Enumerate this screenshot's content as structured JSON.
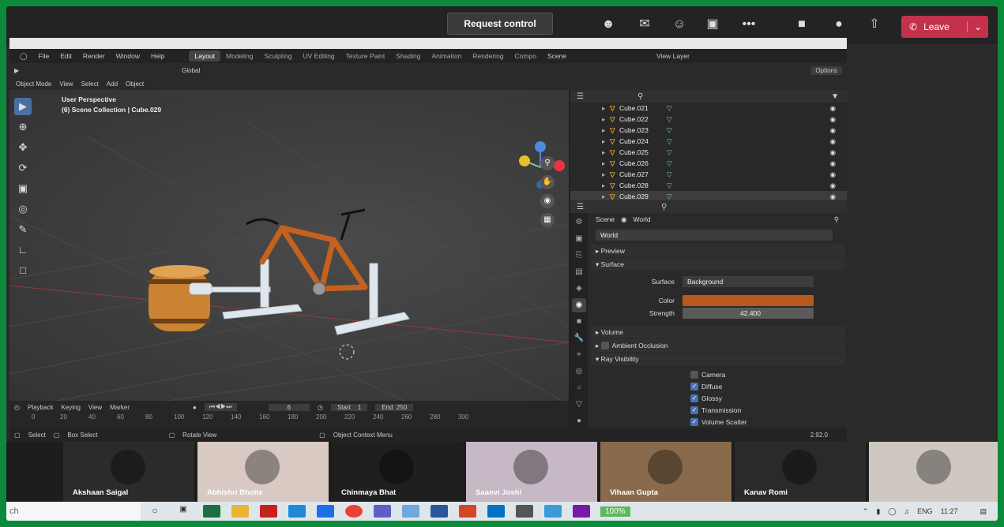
{
  "teams": {
    "request_control": "Request control",
    "leave": "Leave",
    "leave_chevron": "⌄",
    "icons": [
      "people-icon",
      "chat-icon",
      "reactions-icon",
      "share-icon",
      "more-icon",
      "camera-icon",
      "mic-icon",
      "share-tray-icon"
    ],
    "leave_color": "#c4314b"
  },
  "blender": {
    "menu": [
      "File",
      "Edit",
      "Render",
      "Window",
      "Help"
    ],
    "workspaces": [
      "Layout",
      "Modeling",
      "Sculpting",
      "UV Editing",
      "Texture Paint",
      "Shading",
      "Animation",
      "Rendering",
      "Compo"
    ],
    "scene_label": "Scene",
    "view_layer": "View Layer",
    "transform": "Global",
    "options": "Options",
    "mode": "Object Mode",
    "header_items": [
      "View",
      "Select",
      "Add",
      "Object"
    ],
    "viewport_info": {
      "line1": "User Perspective",
      "line2": "(6) Scene Collection | Cube.029"
    },
    "outliner_rows": [
      {
        "name": "Cube.021",
        "selected": false
      },
      {
        "name": "Cube.022",
        "selected": false
      },
      {
        "name": "Cube.023",
        "selected": false
      },
      {
        "name": "Cube.024",
        "selected": false
      },
      {
        "name": "Cube.025",
        "selected": false
      },
      {
        "name": "Cube.026",
        "selected": false
      },
      {
        "name": "Cube.027",
        "selected": false
      },
      {
        "name": "Cube.028",
        "selected": false
      },
      {
        "name": "Cube.029",
        "selected": true
      }
    ],
    "properties": {
      "scene_tab": "Scene",
      "world_tab": "World",
      "world_name": "World",
      "preview": "Preview",
      "surface_section": "Surface",
      "surface_label": "Surface",
      "surface_value": "Background",
      "color_label": "Color",
      "color_value": "#b8581c",
      "strength_label": "Strength",
      "strength_value": "42.400",
      "volume": "Volume",
      "ambient_occlusion": "Ambient Occlusion",
      "ray_visibility": "Ray Visibility",
      "checks": [
        {
          "label": "Camera",
          "checked": false
        },
        {
          "label": "Diffuse",
          "checked": true
        },
        {
          "label": "Glossy",
          "checked": true
        },
        {
          "label": "Transmission",
          "checked": true
        },
        {
          "label": "Volume Scatter",
          "checked": true
        }
      ]
    },
    "timeline": {
      "playback": "Playback",
      "keying": "Keying",
      "view": "View",
      "marker": "Marker",
      "current_frame": "6",
      "start_label": "Start",
      "start_value": "1",
      "end_label": "End",
      "end_value": "250",
      "ruler": [
        "0",
        "20",
        "40",
        "60",
        "80",
        "100",
        "120",
        "140",
        "160",
        "180",
        "200",
        "220",
        "240",
        "260",
        "280",
        "300"
      ]
    },
    "status": {
      "select": "Select",
      "box_select": "Box Select",
      "rotate_view": "Rotate View",
      "context_menu": "Object Context Menu",
      "version": "2.92.0"
    }
  },
  "participants": [
    {
      "name": "Akshaan Saigal",
      "bg": "#2b2b2b"
    },
    {
      "name": "Abhishri Bhoite",
      "bg": "#d8c9c2"
    },
    {
      "name": "Chinmaya Bhat",
      "bg": "#1f1f1f"
    },
    {
      "name": "Saanvi Joshi",
      "bg": "#c6b8c4"
    },
    {
      "name": "Vihaan Gupta",
      "bg": "#8a6a4c"
    },
    {
      "name": "Kanav Romi",
      "bg": "#2a2a2a"
    },
    {
      "name": "",
      "bg": "#cfc8c0"
    }
  ],
  "taskbar": {
    "search_text": "ch",
    "zoom": "100%",
    "lang": "ENG",
    "time": "11:27"
  }
}
